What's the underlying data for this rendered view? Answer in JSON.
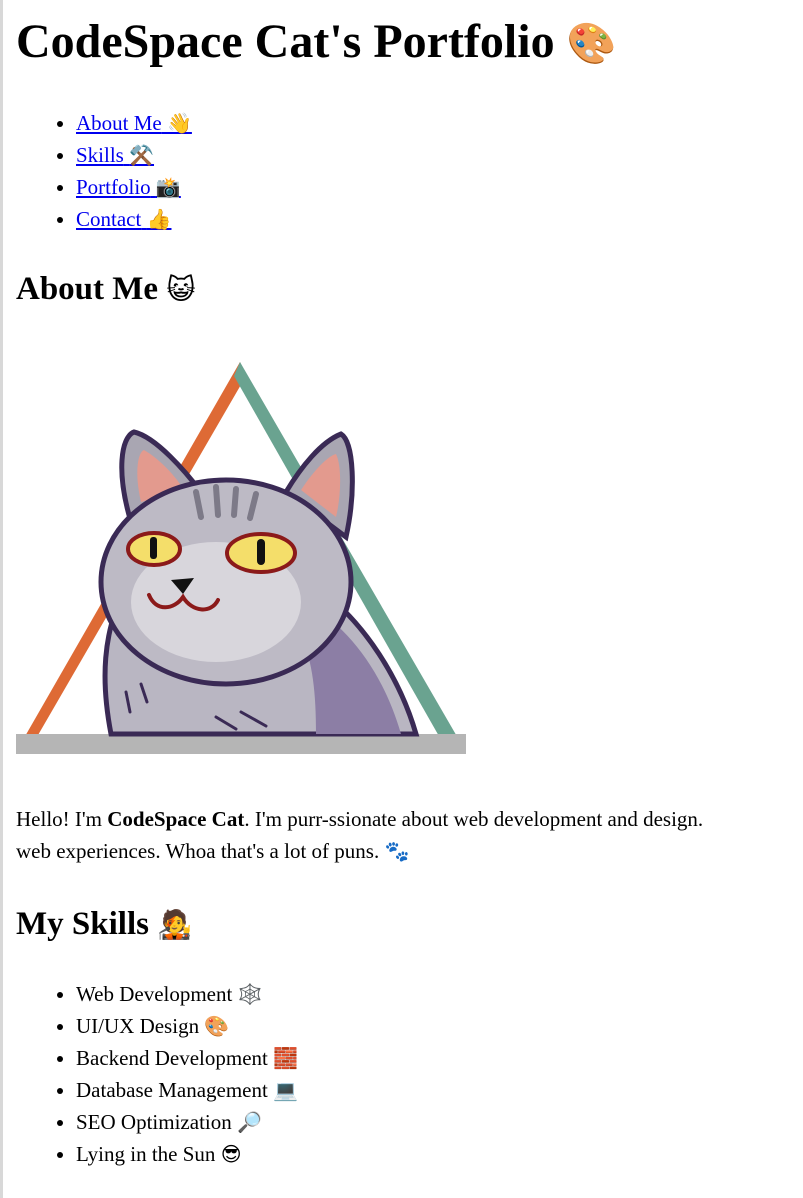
{
  "header": {
    "title": "CodeSpace Cat's Portfolio",
    "title_emoji": "🎨"
  },
  "nav": {
    "items": [
      {
        "label": "About Me",
        "emoji": "👋"
      },
      {
        "label": "Skills",
        "emoji": "⚒️"
      },
      {
        "label": "Portfolio",
        "emoji": "📸"
      },
      {
        "label": "Contact",
        "emoji": "👍"
      }
    ]
  },
  "about": {
    "title": "About Me",
    "title_emoji": "😺",
    "intro_prefix": "Hello! I'm ",
    "intro_name": "CodeSpace Cat",
    "intro_line1_rest": ". I'm purr-ssionate about web development and design.",
    "intro_line2": "web experiences. Whoa that's a lot of puns.",
    "intro_emoji": "🐾"
  },
  "skills": {
    "title": "My Skills",
    "title_emoji": "🧑‍🎤",
    "items": [
      {
        "label": "Web Development",
        "emoji": "🕸️"
      },
      {
        "label": "UI/UX Design",
        "emoji": "🎨"
      },
      {
        "label": "Backend Development",
        "emoji": "🧱"
      },
      {
        "label": "Database Management",
        "emoji": "💻"
      },
      {
        "label": "SEO Optimization",
        "emoji": "🔎"
      },
      {
        "label": "Lying in the Sun",
        "emoji": "😎"
      }
    ]
  },
  "colors": {
    "link": "#0000ee",
    "triangle_left": "#de6a35",
    "triangle_right": "#6aa390",
    "triangle_base": "#b5b5b5",
    "cat_fur": "#b9b6c2",
    "cat_outline": "#3a2a55"
  }
}
